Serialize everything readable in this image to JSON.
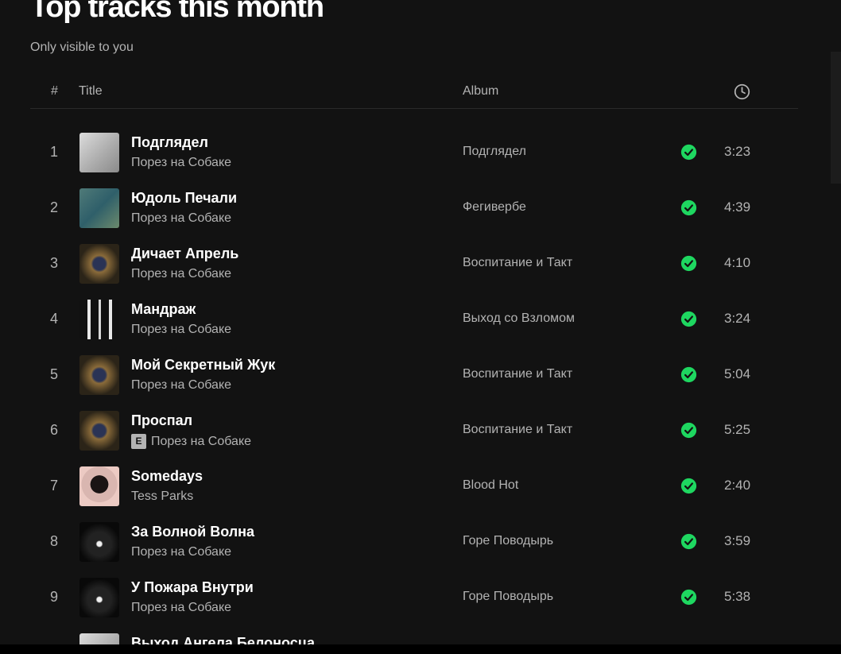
{
  "header": {
    "title": "Top tracks this month",
    "subtitle": "Only visible to you"
  },
  "columns": {
    "number": "#",
    "title": "Title",
    "album": "Album",
    "duration_icon": "clock-icon"
  },
  "tracks": [
    {
      "n": "1",
      "title": "Подглядел",
      "artist": "Порез на Собаке",
      "album": "Подглядел",
      "duration": "3:23",
      "explicit": false,
      "cover": "cover-grey"
    },
    {
      "n": "2",
      "title": "Юдоль Печали",
      "artist": "Порез на Собаке",
      "album": "Фегивербе",
      "duration": "4:39",
      "explicit": false,
      "cover": "cover-teal"
    },
    {
      "n": "3",
      "title": "Дичает Апрель",
      "artist": "Порез на Собаке",
      "album": "Воспитание и Такт",
      "duration": "4:10",
      "explicit": false,
      "cover": "cover-gold"
    },
    {
      "n": "4",
      "title": "Мандраж",
      "artist": "Порез на Собаке",
      "album": "Выход со Взломом",
      "duration": "3:24",
      "explicit": false,
      "cover": "cover-bw"
    },
    {
      "n": "5",
      "title": "Мой Секретный Жук",
      "artist": "Порез на Собаке",
      "album": "Воспитание и Такт",
      "duration": "5:04",
      "explicit": false,
      "cover": "cover-gold"
    },
    {
      "n": "6",
      "title": "Проспал",
      "artist": "Порез на Собаке",
      "album": "Воспитание и Такт",
      "duration": "5:25",
      "explicit": true,
      "cover": "cover-gold"
    },
    {
      "n": "7",
      "title": "Somedays",
      "artist": "Tess Parks",
      "album": "Blood Hot",
      "duration": "2:40",
      "explicit": false,
      "cover": "cover-pink"
    },
    {
      "n": "8",
      "title": "За Волной Волна",
      "artist": "Порез на Собаке",
      "album": "Горе Поводырь",
      "duration": "3:59",
      "explicit": false,
      "cover": "cover-dark"
    },
    {
      "n": "9",
      "title": "У Пожара Внутри",
      "artist": "Порез на Собаке",
      "album": "Горе Поводырь",
      "duration": "5:38",
      "explicit": false,
      "cover": "cover-dark"
    },
    {
      "n": "",
      "title": "Выход Ангела Белоносца",
      "artist": "",
      "album": "",
      "duration": "",
      "explicit": false,
      "cover": "cover-grey"
    }
  ],
  "explicit_badge": "E",
  "colors": {
    "background": "#121212",
    "accent_green": "#1ed760",
    "secondary_text": "#b3b3b3"
  }
}
